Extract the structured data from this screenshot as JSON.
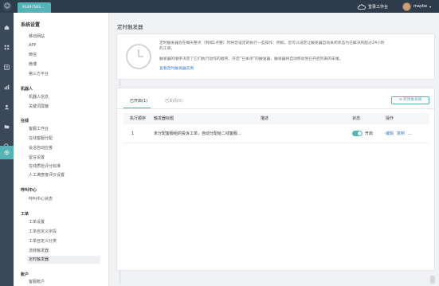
{
  "topbar": {
    "tab_label": "91497583...",
    "login_workspace": "登录工作台",
    "username": "maybe"
  },
  "rail": {
    "items": [
      {
        "icon": "home-icon"
      },
      {
        "icon": "grid-icon"
      },
      {
        "icon": "list-icon"
      },
      {
        "icon": "stats-icon"
      },
      {
        "icon": "user-icon"
      },
      {
        "icon": "folder-icon"
      },
      {
        "icon": "search-icon"
      },
      {
        "icon": "gear-icon"
      }
    ]
  },
  "sidebar": {
    "title": "系统设置",
    "sections": [
      {
        "heading": "",
        "items": [
          "移动网站",
          "APP",
          "微信",
          "微博",
          "第三方平台"
        ]
      },
      {
        "heading": "机器人",
        "items": [
          "机器人信息",
          "关键词屏蔽"
        ]
      },
      {
        "heading": "在线",
        "items": [
          "客服工作台",
          "在线客服分配",
          "会话自动应答",
          "留言设置",
          "在线质检评分标准",
          "人工满意度评价设置"
        ]
      },
      {
        "heading": "呼叫中心",
        "items": [
          "呼叫中心状态"
        ]
      },
      {
        "heading": "工单",
        "items": [
          "工单设置",
          "工单自定义字段",
          "工单自定义分类",
          "流转触发器",
          "定时触发器"
        ]
      },
      {
        "heading": "账户",
        "items": [
          "客服账户"
        ]
      }
    ],
    "active_item": "定时触发器"
  },
  "main": {
    "title": "定时触发器",
    "notice": {
      "line1": "定时触发器会在每天整点（例如1点整）时将您设定的执行一些操作：例如，您可以设定让触发器自动关闭状态为已解决的超过24小时",
      "line2": "的工单。",
      "line3": "触发器的顺序决定了它们执行动作的顺序。开启“已关闭”的触发器，触发器将自动移动到已开启列表的末尾。",
      "link": "查看定时触发器实例"
    },
    "tabs": [
      {
        "label": "已开启(1)"
      },
      {
        "label": "已关闭(0)"
      }
    ],
    "new_button": "新建触发器",
    "table": {
      "headers": [
        "执行顺序",
        "触发器标题",
        "描述",
        "状态",
        "操作"
      ],
      "rows": [
        {
          "order": "1",
          "title": "未分配客服组的投诉工单，自动分配给二线客服...",
          "description": "",
          "status": "开启",
          "status_on": true,
          "ops": [
            "编辑",
            "复制",
            "..."
          ]
        }
      ]
    }
  }
}
